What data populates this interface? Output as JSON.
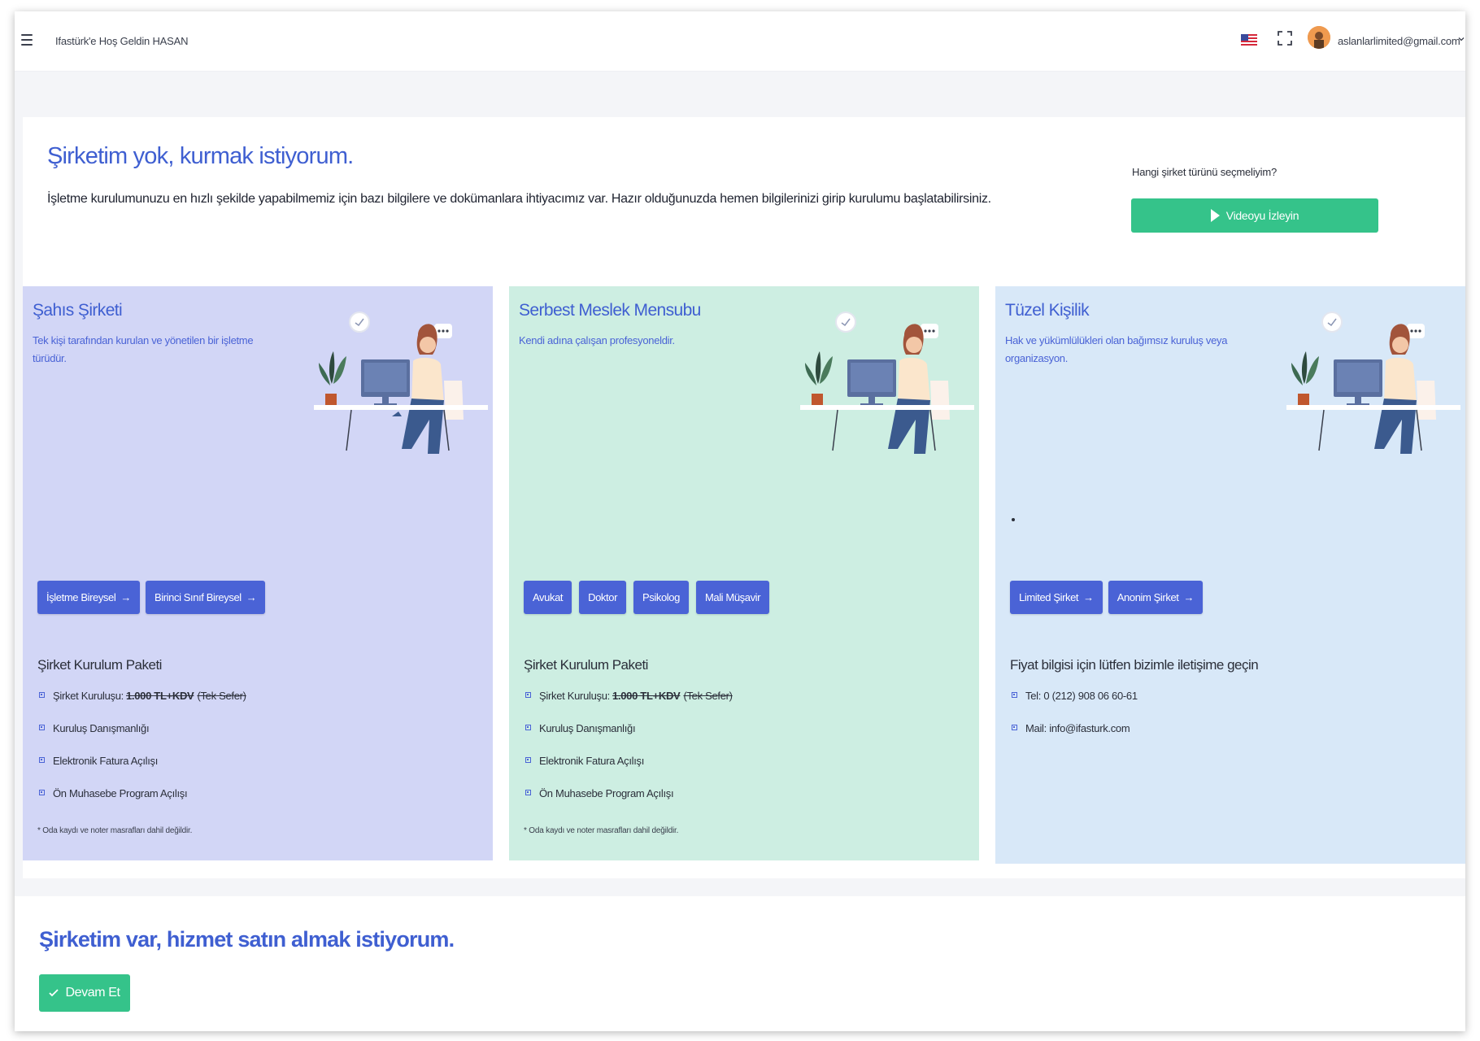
{
  "topbar": {
    "welcome": "Ifastürk'e Hoş Geldin HASAN",
    "user_email": "aslanlarlimited@gmail.com",
    "language_flag": "us-flag-icon"
  },
  "setup": {
    "title": "Şirketim yok, kurmak istiyorum.",
    "lead": "İşletme kurulumunuzu en hızlı şekilde yapabilmemiz için bazı bilgilere ve dokümanlara ihtiyacımız var. Hazır olduğunuzda hemen bilgilerinizi girip kurulumu başlatabilirsiniz.",
    "video_question": "Hangi şirket türünü seçmeliyim?",
    "video_button": "Videoyu İzleyin"
  },
  "columns": [
    {
      "title": "Şahıs Şirketi",
      "desc": "Tek kişi tarafından kurulan ve yönetilen bir işletme türüdür.",
      "buttons": [
        "İşletme Bireysel",
        "Birinci Sınıf Bireysel"
      ],
      "pkg_title": "Şirket Kurulum Paketi",
      "items": {
        "setup_prefix": "Şirket Kuruluşu:",
        "setup_price": "1.000 TL+KDV",
        "setup_once": "(Tek Sefer)",
        "item2": "Kuruluş Danışmanlığı",
        "item3": "Elektronik Fatura Açılışı",
        "item4": "Ön Muhasebe Program Açılışı"
      },
      "note": "* Oda kaydı ve noter masrafları dahil değildir."
    },
    {
      "title": "Serbest Meslek Mensubu",
      "desc": "Kendi adına çalışan profesyoneldir.",
      "buttons": [
        "Avukat",
        "Doktor",
        "Psikolog",
        "Mali Müşavir"
      ],
      "pkg_title": "Şirket Kurulum Paketi",
      "items": {
        "setup_prefix": "Şirket Kuruluşu:",
        "setup_price": "1.000 TL+KDV",
        "setup_once": "(Tek Sefer)",
        "item2": "Kuruluş Danışmanlığı",
        "item3": "Elektronik Fatura Açılışı",
        "item4": "Ön Muhasebe Program Açılışı"
      },
      "note": "* Oda kaydı ve noter masrafları dahil değildir."
    },
    {
      "title": "Tüzel Kişilik",
      "desc": "Hak ve yükümlülükleri olan bağımsız kuruluş veya organizasyon.",
      "buttons": [
        "Limited Şirket",
        "Anonim Şirket"
      ],
      "pkg_title": "Fiyat bilgisi için lütfen bizimle iletişime geçin",
      "contact": {
        "phone": "Tel: 0 (212) 908 06 60-61",
        "mail": "Mail: info@ifasturk.com"
      }
    }
  ],
  "existing": {
    "title": "Şirketim var, hizmet satın almak istiyorum.",
    "button": "Devam Et"
  },
  "colors": {
    "primary": "#4a63d6",
    "title_blue": "#3f5fd1",
    "green": "#35c38a",
    "col1_bg": "#d2d6f6",
    "col2_bg": "#cdeee2",
    "col3_bg": "#d8e8f8"
  }
}
